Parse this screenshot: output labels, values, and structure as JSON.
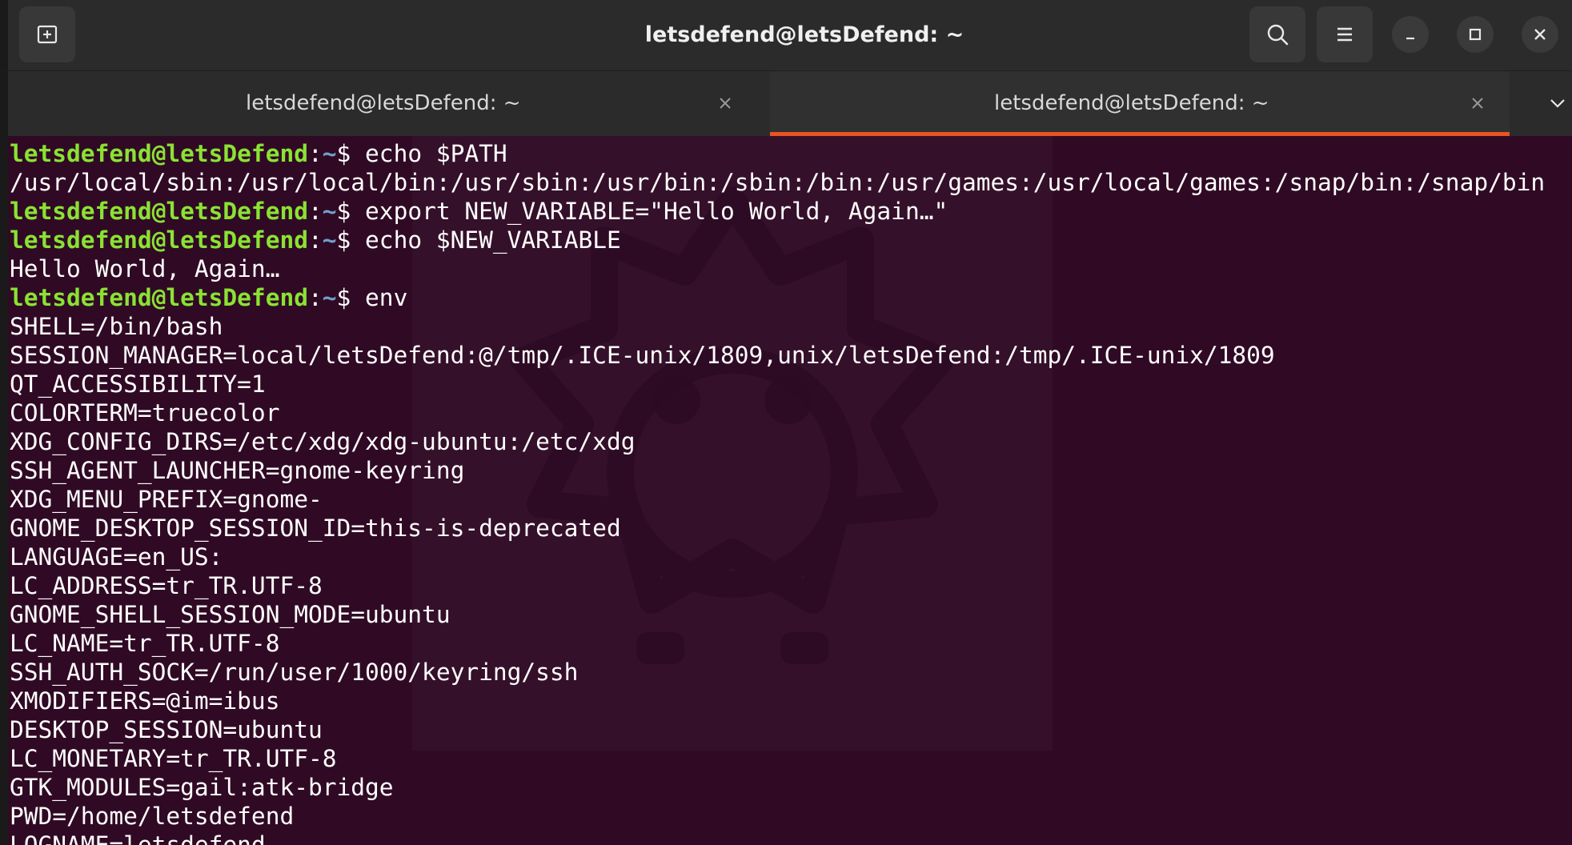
{
  "window": {
    "title": "letsdefend@letsDefend: ~"
  },
  "tabs": [
    {
      "label": "letsdefend@letsDefend: ~",
      "active": false
    },
    {
      "label": "letsdefend@letsDefend: ~",
      "active": true
    }
  ],
  "icons": {
    "new_tab": "new-tab-icon",
    "search": "search-icon",
    "menu": "hamburger-menu-icon",
    "minimize": "minimize-icon",
    "maximize": "maximize-icon",
    "close": "close-icon",
    "tab_close": "close-icon",
    "tab_dropdown": "chevron-down-icon"
  },
  "colors": {
    "terminal_bg": "#300a24",
    "prompt_user": "#8ae234",
    "prompt_path": "#729fcf",
    "accent": "#e95420"
  },
  "prompt": {
    "user_host": "letsdefend@letsDefend",
    "separator": ":",
    "path": "~",
    "symbol": "$ "
  },
  "terminal": {
    "lines": [
      {
        "type": "cmd",
        "text": "echo $PATH"
      },
      {
        "type": "out",
        "text": "/usr/local/sbin:/usr/local/bin:/usr/sbin:/usr/bin:/sbin:/bin:/usr/games:/usr/local/games:/snap/bin:/snap/bin"
      },
      {
        "type": "cmd",
        "text": "export NEW_VARIABLE=\"Hello World, Again…\""
      },
      {
        "type": "cmd",
        "text": "echo $NEW_VARIABLE"
      },
      {
        "type": "out",
        "text": "Hello World, Again…"
      },
      {
        "type": "cmd",
        "text": "env"
      },
      {
        "type": "out",
        "text": "SHELL=/bin/bash"
      },
      {
        "type": "out",
        "text": "SESSION_MANAGER=local/letsDefend:@/tmp/.ICE-unix/1809,unix/letsDefend:/tmp/.ICE-unix/1809"
      },
      {
        "type": "out",
        "text": "QT_ACCESSIBILITY=1"
      },
      {
        "type": "out",
        "text": "COLORTERM=truecolor"
      },
      {
        "type": "out",
        "text": "XDG_CONFIG_DIRS=/etc/xdg/xdg-ubuntu:/etc/xdg"
      },
      {
        "type": "out",
        "text": "SSH_AGENT_LAUNCHER=gnome-keyring"
      },
      {
        "type": "out",
        "text": "XDG_MENU_PREFIX=gnome-"
      },
      {
        "type": "out",
        "text": "GNOME_DESKTOP_SESSION_ID=this-is-deprecated"
      },
      {
        "type": "out",
        "text": "LANGUAGE=en_US:"
      },
      {
        "type": "out",
        "text": "LC_ADDRESS=tr_TR.UTF-8"
      },
      {
        "type": "out",
        "text": "GNOME_SHELL_SESSION_MODE=ubuntu"
      },
      {
        "type": "out",
        "text": "LC_NAME=tr_TR.UTF-8"
      },
      {
        "type": "out",
        "text": "SSH_AUTH_SOCK=/run/user/1000/keyring/ssh"
      },
      {
        "type": "out",
        "text": "XMODIFIERS=@im=ibus"
      },
      {
        "type": "out",
        "text": "DESKTOP_SESSION=ubuntu"
      },
      {
        "type": "out",
        "text": "LC_MONETARY=tr_TR.UTF-8"
      },
      {
        "type": "out",
        "text": "GTK_MODULES=gail:atk-bridge"
      },
      {
        "type": "out",
        "text": "PWD=/home/letsdefend"
      },
      {
        "type": "out",
        "text": "LOGNAME=letsdefend"
      }
    ]
  }
}
